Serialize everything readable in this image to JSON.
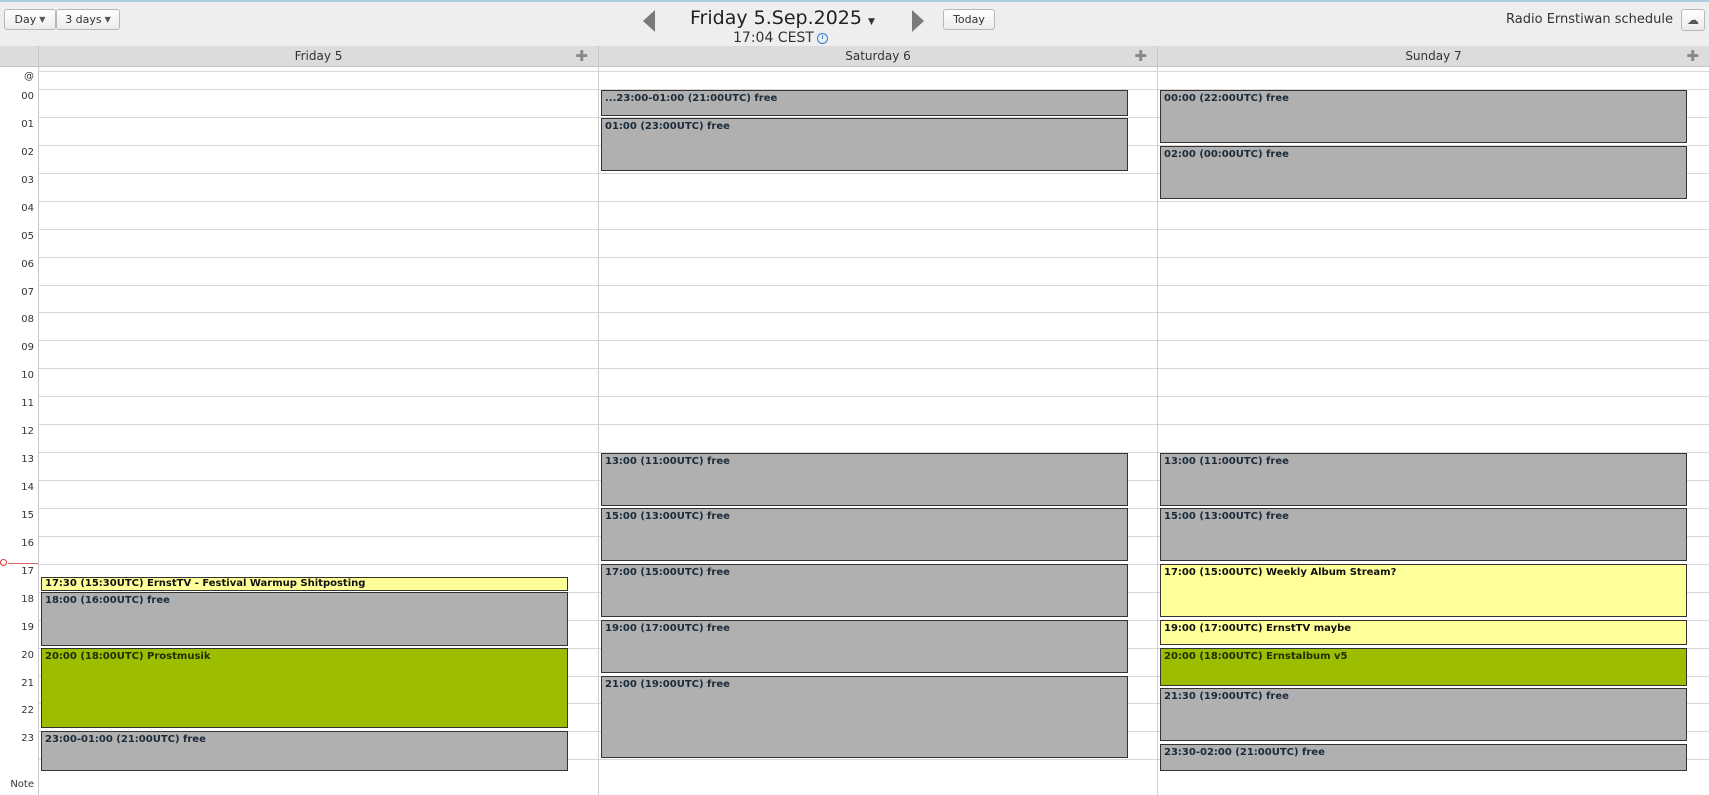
{
  "toolbar": {
    "view_day": "Day",
    "view_3days": "3 days",
    "date_title": "Friday 5.Sep.2025",
    "time_display": "17:04 CEST",
    "today_label": "Today",
    "schedule_name": "Radio Ernstiwan schedule",
    "icons": {
      "prev": "triangle-left-icon",
      "next": "triangle-right-icon",
      "caret": "chevron-down-icon",
      "clock": "clock-icon",
      "cloud": "cloud-icon",
      "add": "plus-icon"
    }
  },
  "days": [
    {
      "label": "Friday 5"
    },
    {
      "label": "Saturday 6"
    },
    {
      "label": "Sunday 7"
    }
  ],
  "allday_label": "@",
  "note_label": "Note",
  "hours": [
    "00",
    "01",
    "02",
    "03",
    "04",
    "05",
    "06",
    "07",
    "08",
    "09",
    "10",
    "11",
    "12",
    "13",
    "14",
    "15",
    "16",
    "17",
    "18",
    "19",
    "20",
    "21",
    "22",
    "23"
  ],
  "events": {
    "friday": [
      {
        "text": "17:30 (15:30UTC) ErnstTV - Festival Warmup Shitposting",
        "kind": "yellow"
      },
      {
        "text": "18:00 (16:00UTC) free",
        "kind": "free"
      },
      {
        "text": "20:00 (18:00UTC) Prostmusik",
        "kind": "green"
      },
      {
        "text": "23:00-01:00 (21:00UTC) free",
        "kind": "free"
      }
    ],
    "saturday": [
      {
        "text": "...23:00-01:00 (21:00UTC) free",
        "kind": "free"
      },
      {
        "text": "01:00 (23:00UTC) free",
        "kind": "free"
      },
      {
        "text": "13:00 (11:00UTC) free",
        "kind": "free"
      },
      {
        "text": "15:00 (13:00UTC) free",
        "kind": "free"
      },
      {
        "text": "17:00 (15:00UTC) free",
        "kind": "free"
      },
      {
        "text": "19:00 (17:00UTC) free",
        "kind": "free"
      },
      {
        "text": "21:00 (19:00UTC) free",
        "kind": "free"
      }
    ],
    "sunday": [
      {
        "text": "00:00 (22:00UTC) free",
        "kind": "free"
      },
      {
        "text": "02:00 (00:00UTC) free",
        "kind": "free"
      },
      {
        "text": "13:00 (11:00UTC) free",
        "kind": "free"
      },
      {
        "text": "15:00 (13:00UTC) free",
        "kind": "free"
      },
      {
        "text": "17:00 (15:00UTC) Weekly Album Stream?",
        "kind": "yellow"
      },
      {
        "text": "19:00 (17:00UTC) ErnstTV maybe",
        "kind": "yellow"
      },
      {
        "text": "20:00 (18:00UTC) Ernstalbum v5",
        "kind": "green"
      },
      {
        "text": "21:30 (19:00UTC) free",
        "kind": "free"
      },
      {
        "text": "23:30-02:00 (21:00UTC) free",
        "kind": "free"
      }
    ]
  },
  "colors": {
    "free": "#b0b0b0",
    "yellow": "#ffff99",
    "green": "#9dbd00",
    "now_marker": "#e03030"
  }
}
